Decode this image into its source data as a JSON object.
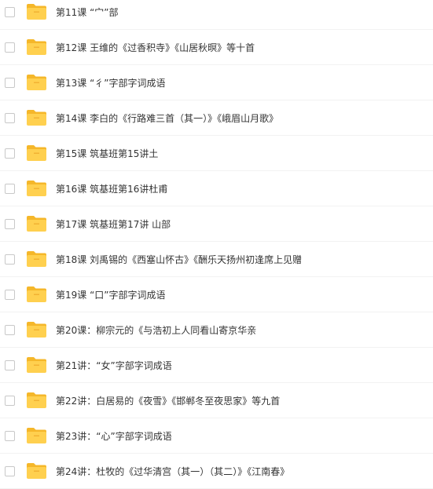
{
  "files": [
    {
      "name": "第11课 “宀”部"
    },
    {
      "name": "第12课 王维的《过香积寺》《山居秋暝》等十首"
    },
    {
      "name": "第13课 “彳”字部字词成语"
    },
    {
      "name": "第14课 李白的《行路难三首（其一）》《峨眉山月歌》"
    },
    {
      "name": "第15课 筑基班第15讲土"
    },
    {
      "name": "第16课 筑基班第16讲杜甫"
    },
    {
      "name": "第17课 筑基班第17讲 山部"
    },
    {
      "name": "第18课 刘禹锡的《西塞山怀古》《酬乐天扬州初逢席上见赠"
    },
    {
      "name": "第19课 “口”字部字词成语"
    },
    {
      "name": "第20课：柳宗元的《与浩初上人同看山寄京华亲"
    },
    {
      "name": "第21讲：“女”字部字词成语"
    },
    {
      "name": "第22讲：白居易的《夜雪》《邯郸冬至夜思家》等九首"
    },
    {
      "name": "第23讲：“心”字部字词成语"
    },
    {
      "name": "第24讲：杜牧的《过华清宫（其一）（其二）》《江南春》"
    }
  ],
  "colors": {
    "folder_back": "#F5B72A",
    "folder_front": "#FFD04F",
    "folder_stripe": "#F2B233",
    "text": "#333333"
  },
  "icons": {
    "folder": "folder-icon",
    "checkbox": "checkbox"
  }
}
